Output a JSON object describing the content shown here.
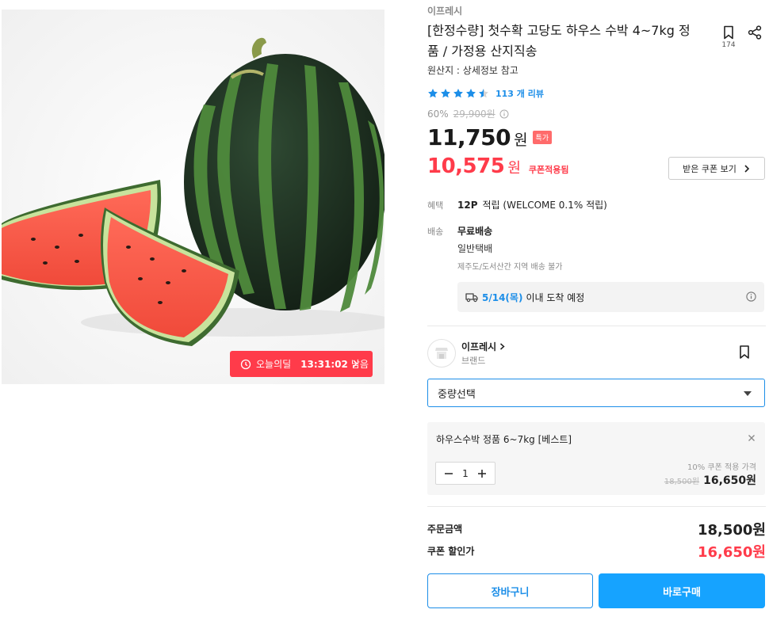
{
  "product": {
    "brand_top": "이프레시",
    "title": "[한정수량] 첫수확 고당도 하우스 수박 4~7kg 정품 / 가정용 산지직송",
    "bookmark_count": "174",
    "origin": "원산지 : 상세정보 참고",
    "rating": 4.5,
    "review_text": "113 개 리뷰",
    "discount_rate": "60%",
    "original_price": "29,900원",
    "price": "11,750",
    "price_unit": "원",
    "special_badge": "특가",
    "coupon_price": "10,575",
    "coupon_price_unit": "원",
    "coupon_label": "쿠폰적용됨",
    "coupon_button": "받은 쿠폰 보기"
  },
  "deal": {
    "label": "오늘의딜",
    "time": "13:31:02",
    "suffix": "남음"
  },
  "benefit": {
    "label": "혜택",
    "points": "12P",
    "desc": "적립 (WELCOME 0.1% 적립)"
  },
  "shipping": {
    "label": "배송",
    "free": "무료배송",
    "type": "일반택배",
    "note": "제주도/도서산간 지역 배송 불가",
    "arrival_date": "5/14(목)",
    "arrival_text": "이내 도착 예정"
  },
  "seller": {
    "name": "이프레시",
    "sub": "브랜드"
  },
  "option_select": {
    "placeholder": "중량선택"
  },
  "selected_option": {
    "name": "하우스수박 정품 6~7kg [베스트]",
    "quantity": "1",
    "coupon_label": "10% 쿠폰 적용 가격",
    "original": "18,500원",
    "price": "16,650원"
  },
  "summary": {
    "order_label": "주문금액",
    "order_value": "18,500원",
    "coupon_label": "쿠폰 할인가",
    "coupon_value": "16,650원"
  },
  "actions": {
    "cart": "장바구니",
    "buy": "바로구매"
  },
  "colors": {
    "accent_blue": "#1c8ee8",
    "buy_blue": "#16a3ff",
    "sale_red": "#ff3b4a"
  }
}
